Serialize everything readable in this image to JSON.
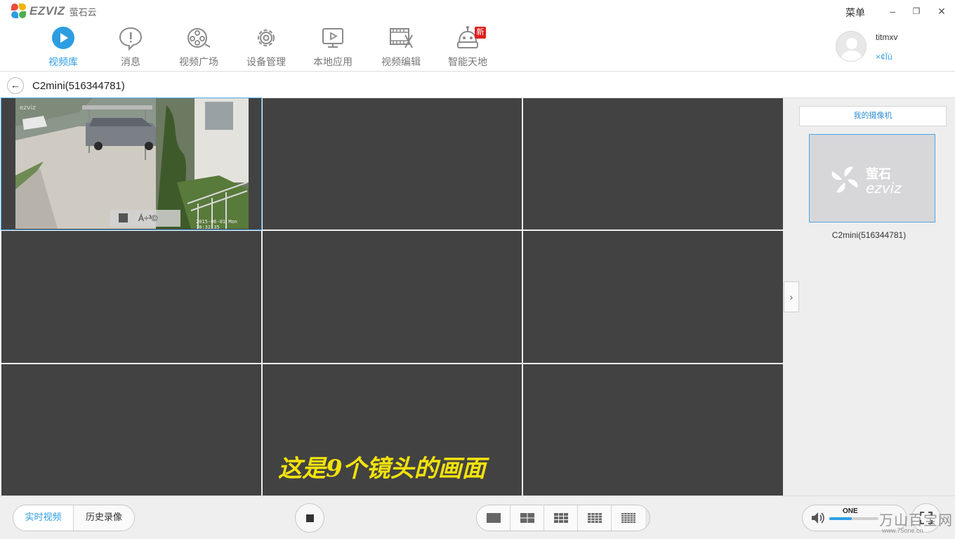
{
  "window": {
    "brand": "EZVIZ",
    "brand_cn": "萤石云",
    "menu_label": "菜单",
    "minimize": "–",
    "restore": "❐",
    "close": "✕"
  },
  "nav": {
    "items": [
      {
        "label": "视频库",
        "icon": "play-circle-icon",
        "active": true
      },
      {
        "label": "消息",
        "icon": "message-icon"
      },
      {
        "label": "视频广场",
        "icon": "film-reel-icon"
      },
      {
        "label": "设备管理",
        "icon": "gear-icon"
      },
      {
        "label": "本地应用",
        "icon": "monitor-play-icon"
      },
      {
        "label": "视频编辑",
        "icon": "film-scissors-icon"
      },
      {
        "label": "智能天地",
        "icon": "robot-icon",
        "badge": "新"
      }
    ]
  },
  "user": {
    "name": "titmxv",
    "logout_label": "×¢Ïú"
  },
  "breadcrumb": {
    "back_icon": "back-arrow-icon",
    "title": "C2mini(516344781)"
  },
  "grid": {
    "cells": 9,
    "active_feed": {
      "quality_label": "Á÷³©",
      "timestamp": "2015-06-01 Mon 10:32:35"
    },
    "overlay_caption": "这是9个镜头的画面"
  },
  "sidebar": {
    "tab_label": "我的摄像机",
    "camera_name": "C2mini(516344781)",
    "thumb_brand_cn": "萤石",
    "thumb_brand": "ezviz"
  },
  "bottombar": {
    "mode_tabs": [
      {
        "label": "实时视频",
        "active": true
      },
      {
        "label": "历史录像",
        "active": false
      }
    ],
    "layouts": [
      "1x1",
      "2x2",
      "3x3",
      "4x4",
      "5x5"
    ],
    "volume_level": 0.45
  },
  "watermark": {
    "logo": "ONE",
    "text": "万山百宝网",
    "url": "www.75one.cn"
  },
  "colors": {
    "accent": "#2d9de2",
    "cell": "#424242",
    "caption": "#f2e20c",
    "badge": "#e02020"
  }
}
